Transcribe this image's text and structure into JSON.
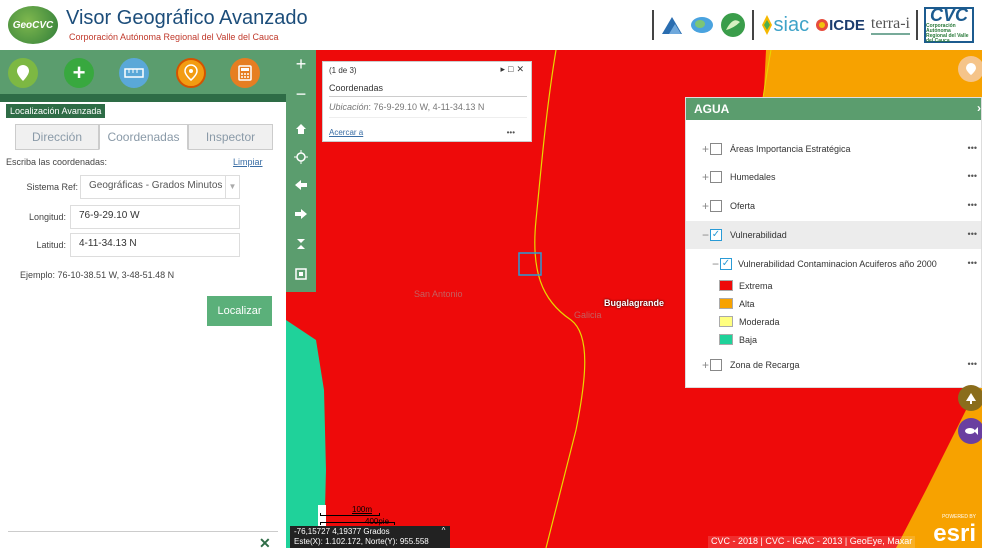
{
  "header": {
    "logo_text": "GeoCVC",
    "title": "Visor Geográfico Avanzado",
    "subtitle": "Corporación Autónoma Regional del Valle del Cauca",
    "partners": {
      "siac": "siac",
      "icde": "ICDE",
      "terra": "terra-i",
      "cvc": "CVC",
      "cvc_sub": "Corporación Autónoma Regional del Valle del Cauca"
    }
  },
  "toolbar": {
    "tools": [
      {
        "icon": "map-pin-icon",
        "color": "#7db843"
      },
      {
        "icon": "plus-icon",
        "color": "#38a83f"
      },
      {
        "icon": "ruler-icon",
        "color": "#5aa8d8"
      },
      {
        "icon": "location-xy-icon",
        "color": "#f39c12",
        "label": "XY"
      },
      {
        "icon": "calculator-icon",
        "color": "#e67e22"
      }
    ]
  },
  "panel": {
    "title": "Localización Avanzada",
    "tabs": [
      {
        "label": "Dirección",
        "active": false
      },
      {
        "label": "Coordenadas",
        "active": true
      },
      {
        "label": "Inspector",
        "active": false
      }
    ],
    "instructions": "Escriba las coordenadas:",
    "clear_link": "Limpiar",
    "ref_label": "Sistema Ref:",
    "ref_value": "Geográficas - Grados Minutos",
    "lon_label": "Longitud:",
    "lon_value": "76-9-29.10 W",
    "lat_label": "Latitud:",
    "lat_value": "4-11-34.13 N",
    "example_label": "Ejemplo:",
    "example_value": "76-10-38.51 W, 3-48-51.48 N",
    "locate_button": "Localizar",
    "close_icon": "✕"
  },
  "popup": {
    "count": "(1 de 3)",
    "title": "Coordenadas",
    "location_label": "Ubicación",
    "location_value": ": 76-9-29.10 W, 4-11-34.13 N",
    "zoom_link": "Acercar a",
    "more": "•••"
  },
  "layers": {
    "title": "AGUA",
    "close": "›",
    "items": [
      {
        "label": "Áreas Importancia Estratégica",
        "checked": false
      },
      {
        "label": "Humedales",
        "checked": false
      },
      {
        "label": "Oferta",
        "checked": false
      },
      {
        "label": "Vulnerabilidad",
        "checked": true
      },
      {
        "label": "Zona de Recarga",
        "checked": false
      }
    ],
    "sublayer": "Vulnerabilidad Contaminacion Acuiferos año 2000",
    "legend": [
      {
        "label": "Extrema",
        "color": "#ee0a0a"
      },
      {
        "label": "Alta",
        "color": "#f7a200"
      },
      {
        "label": "Moderada",
        "color": "#ffff80"
      },
      {
        "label": "Baja",
        "color": "#1fd29a"
      }
    ]
  },
  "map": {
    "labels": {
      "place1": "San Antonio",
      "place2": "Bugalagrande",
      "place3": "Galicia"
    },
    "scale": {
      "top": "100m",
      "bottom": "400pie"
    },
    "coords_line1": "-76,15727 4,19377 Grados",
    "coords_line2": "Este(X): 1.102.172, Norte(Y): 955.558",
    "attribution": "CVC - 2018 | CVC - IGAC - 2013 | GeoEye, Maxar",
    "esri": "esri",
    "esri_powered": "POWERED BY"
  }
}
